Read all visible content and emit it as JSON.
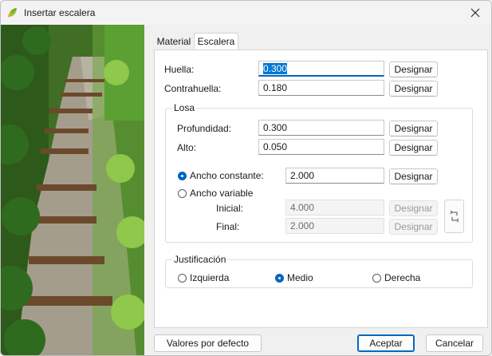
{
  "window": {
    "title": "Insertar escalera",
    "close_icon": "close-icon"
  },
  "tabs": [
    {
      "label": "Material"
    },
    {
      "label": "Escalera"
    }
  ],
  "huella": {
    "label": "Huella:",
    "value": "0.300",
    "button": "Designar"
  },
  "contrahuella": {
    "label": "Contrahuella:",
    "value": "0.180",
    "button": "Designar"
  },
  "losa": {
    "title": "Losa",
    "profundidad": {
      "label": "Profundidad:",
      "value": "0.300",
      "button": "Designar"
    },
    "alto": {
      "label": "Alto:",
      "value": "0.050",
      "button": "Designar"
    },
    "ancho_constante": {
      "label": "Ancho constante:",
      "value": "2.000",
      "button": "Designar",
      "selected": true
    },
    "ancho_variable": {
      "label": "Ancho variable",
      "selected": false
    },
    "inicial": {
      "label": "Inicial:",
      "value": "4.000",
      "button": "Designar"
    },
    "final": {
      "label": "Final:",
      "value": "2.000",
      "button": "Designar"
    },
    "swap_icon": "swap-icon"
  },
  "justificacion": {
    "title": "Justificación",
    "options": [
      {
        "label": "Izquierda",
        "selected": false
      },
      {
        "label": "Medio",
        "selected": true
      },
      {
        "label": "Derecha",
        "selected": false
      }
    ]
  },
  "footer": {
    "defaults": "Valores por defecto",
    "accept": "Aceptar",
    "cancel": "Cancelar"
  },
  "colors": {
    "accent": "#0067c0",
    "photo_grass": "#4f8a2a",
    "photo_path": "#a49d8c"
  }
}
